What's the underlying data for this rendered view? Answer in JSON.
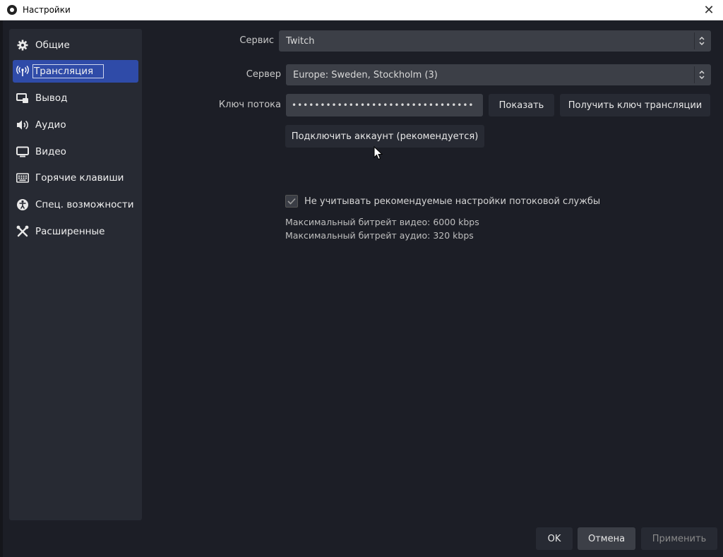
{
  "window": {
    "title": "Настройки",
    "close_glyph": "✕"
  },
  "sidebar": {
    "items": [
      {
        "label": "Общие",
        "icon": "gear-icon"
      },
      {
        "label": "Трансляция",
        "icon": "broadcast-icon"
      },
      {
        "label": "Вывод",
        "icon": "output-icon"
      },
      {
        "label": "Аудио",
        "icon": "speaker-icon"
      },
      {
        "label": "Видео",
        "icon": "monitor-icon"
      },
      {
        "label": "Горячие клавиши",
        "icon": "keyboard-icon"
      },
      {
        "label": "Спец. возможности",
        "icon": "accessibility-icon"
      },
      {
        "label": "Расширенные",
        "icon": "tools-icon"
      }
    ]
  },
  "stream": {
    "service_label": "Сервис",
    "service_value": "Twitch",
    "server_label": "Сервер",
    "server_value": "Europe: Sweden, Stockholm (3)",
    "key_label": "Ключ потока",
    "key_value": "••••••••••••••••••••••••••••••••",
    "show_button": "Показать",
    "get_key_button": "Получить ключ трансляции",
    "connect_button": "Подключить аккаунт (рекомендуется)",
    "ignore_checkbox_label": "Не учитывать рекомендуемые настройки потоковой службы",
    "ignore_checked": true,
    "max_video_bitrate": "Максимальный битрейт видео: 6000 kbps",
    "max_audio_bitrate": "Максимальный битрейт аудио: 320 kbps"
  },
  "footer": {
    "ok": "OK",
    "cancel": "Отмена",
    "apply": "Применить"
  },
  "colors": {
    "accent": "#2f4ba8",
    "background": "#1c1e26",
    "panel": "#272a33",
    "field": "#3c3f47"
  }
}
